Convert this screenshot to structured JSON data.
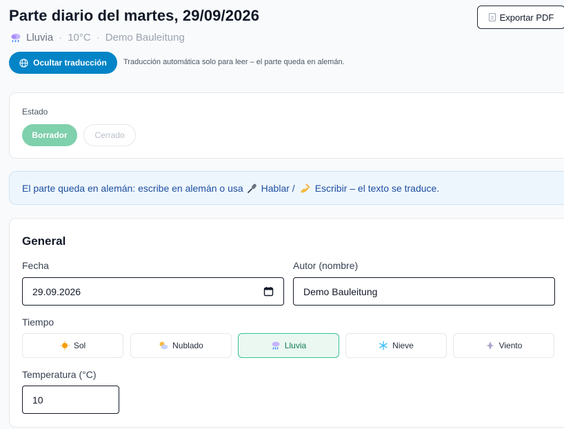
{
  "header": {
    "title": "Parte diario del martes, 29/09/2026",
    "weather": "Lluvia",
    "temperature": "10°C",
    "author": "Demo Bauleitung",
    "separator": "·",
    "export_label": "Exportar PDF"
  },
  "translation": {
    "button_label": "Ocultar traducción",
    "note": "Traducción automática solo para leer – el parte queda en alemán."
  },
  "status": {
    "label": "Estado",
    "options": [
      "Borrador",
      "Cerrado"
    ],
    "selected": "Borrador"
  },
  "info_banner": {
    "text_before": "El parte queda en alemán: escribe en alemán o usa",
    "speak_label": "Hablar /",
    "write_label": "Escribir – el texto se traduce."
  },
  "general": {
    "title": "General",
    "date_label": "Fecha",
    "date_value": "29.09.2026",
    "author_label": "Autor (nombre)",
    "author_value": "Demo Bauleitung",
    "weather_label": "Tiempo",
    "weather_options": [
      {
        "label": "Sol",
        "icon": "sun-icon"
      },
      {
        "label": "Nublado",
        "icon": "partly-cloudy-icon"
      },
      {
        "label": "Lluvia",
        "icon": "rain-cloud-icon"
      },
      {
        "label": "Nieve",
        "icon": "snowflake-icon"
      },
      {
        "label": "Viento",
        "icon": "wind-icon"
      }
    ],
    "weather_selected": "Lluvia",
    "temperature_label": "Temperatura (°C)",
    "temperature_value": "10"
  },
  "colors": {
    "primary": "#0284c7",
    "draft_active": "#7fd0ac",
    "weather_active_border": "#34c293",
    "banner_text": "#1e4fa0"
  }
}
